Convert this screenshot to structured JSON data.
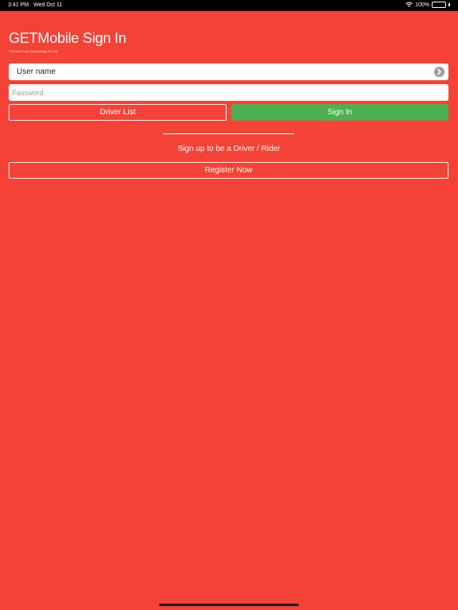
{
  "status_bar": {
    "time": "3:41 PM",
    "date": "Wed Oct 11",
    "battery": "100%",
    "wifi_icon": "wifi-icon",
    "battery_icon": "battery-icon"
  },
  "header": {
    "title": "GETMobile Sign In",
    "subtitle": "Premier Force Technology Pte Ltd"
  },
  "form": {
    "username_placeholder": "User name",
    "password_placeholder": "Password",
    "username_action_icon": "arrow-right-circle-icon"
  },
  "buttons": {
    "driver_list": "Driver List",
    "sign_in": "Sign In",
    "register": "Register Now"
  },
  "signup": {
    "text": "Sign up to be a Driver / Rider"
  },
  "colors": {
    "background": "#f44336",
    "sign_in": "#4caf50",
    "text": "#ffffff"
  }
}
